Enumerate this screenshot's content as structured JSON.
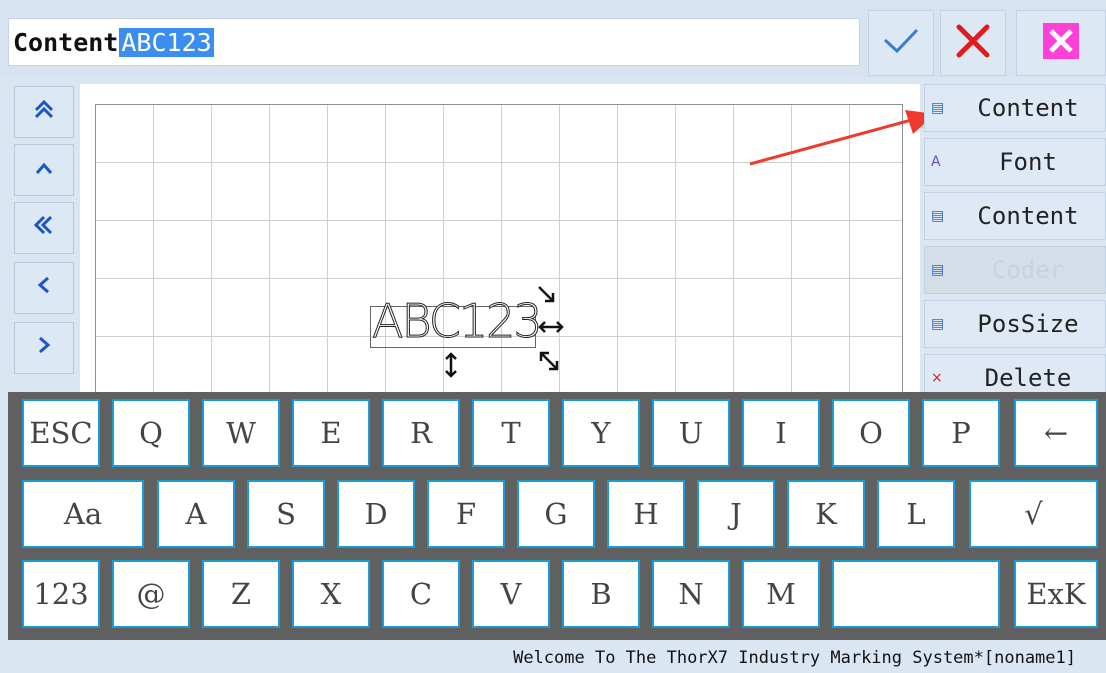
{
  "header": {
    "content_label": "Content",
    "content_value": "ABC123",
    "confirm_icon": "checkmark-icon",
    "cancel_icon": "x-icon",
    "close_icon": "close-box-icon",
    "confirm_glyph": "✓",
    "cancel_glyph": "✕",
    "close_glyph": "✕"
  },
  "left_nav": [
    {
      "name": "move-top",
      "glyph": "⌃"
    },
    {
      "name": "move-up",
      "glyph": "^"
    },
    {
      "name": "move-far-left",
      "glyph": "«"
    },
    {
      "name": "move-left",
      "glyph": "<"
    },
    {
      "name": "move-right",
      "glyph": ">"
    }
  ],
  "canvas": {
    "object_text": "ABC123"
  },
  "side_menu": [
    {
      "label": "Content",
      "icon": "text-box-icon",
      "glyph": "▤",
      "enabled": true
    },
    {
      "label": "Font",
      "icon": "font-icon",
      "glyph": "A",
      "enabled": true
    },
    {
      "label": "Content",
      "icon": "list-icon",
      "glyph": "▤",
      "enabled": true
    },
    {
      "label": "Coder",
      "icon": "list-icon",
      "glyph": "▤",
      "enabled": false
    },
    {
      "label": "PosSize",
      "icon": "list-icon",
      "glyph": "▤",
      "enabled": true
    },
    {
      "label": "Delete",
      "icon": "delete-icon",
      "glyph": "×",
      "enabled": true
    }
  ],
  "keyboard": {
    "row1": [
      "ESC",
      "Q",
      "W",
      "E",
      "R",
      "T",
      "Y",
      "U",
      "I",
      "O",
      "P",
      "←"
    ],
    "row2": [
      "Aa",
      "A",
      "S",
      "D",
      "F",
      "G",
      "H",
      "J",
      "K",
      "L",
      "√"
    ],
    "row3": [
      "123",
      "@",
      "Z",
      "X",
      "C",
      "V",
      "B",
      "N",
      "M",
      "",
      "ExK"
    ]
  },
  "status": {
    "text": "Welcome To The ThorX7 Industry Marking System*[noname1]"
  },
  "colors": {
    "accent": "#1b9ad6",
    "confirm": "#3a7bd5",
    "cancel": "#e01b1b",
    "close_bg": "#ff3fd8",
    "arrow": "#ee3a2d"
  }
}
